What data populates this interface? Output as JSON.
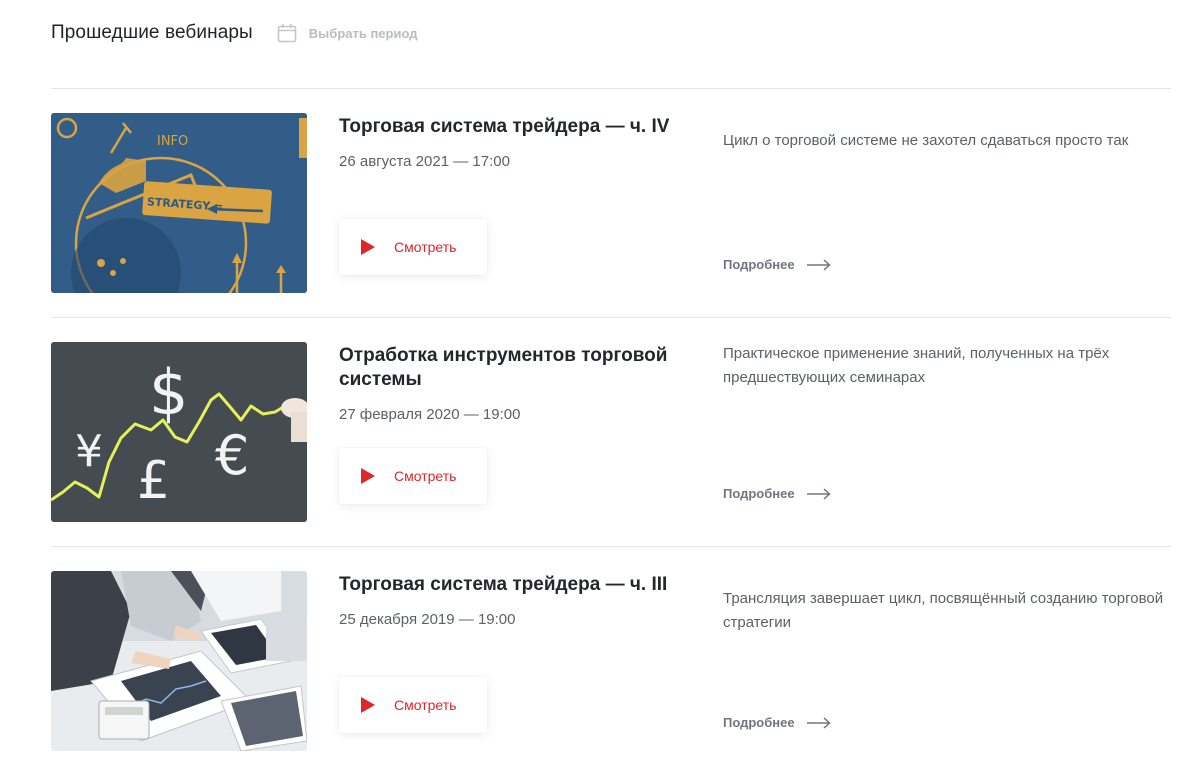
{
  "header": {
    "title": "Прошедшие вебинары",
    "period_label": "Выбрать период"
  },
  "webinars": [
    {
      "title": "Торговая система трейдера — ч. IV",
      "date": "26 августа 2021  — 17:00",
      "watch_label": "Смотреть",
      "description": "Цикл о торговой системе не захотел сдаваться просто так",
      "more_label": "Подробнее",
      "image_text_1": "INFO",
      "image_text_2": "STRATEGY ="
    },
    {
      "title": "Отработка инструментов торговой системы",
      "date": "27 февраля 2020  — 19:00",
      "watch_label": "Смотреть",
      "description": "Практическое применение знаний, полученных на трёх предшествующих семинарах",
      "more_label": "Подробнее",
      "image_symbols": [
        "$",
        "¥",
        "£",
        "€"
      ]
    },
    {
      "title": "Торговая система трейдера — ч. III",
      "date": "25 декабря 2019  — 19:00",
      "watch_label": "Смотреть",
      "description": "Трансляция завершает цикл, посвящённый созданию торговой стратегии",
      "more_label": "Подробнее"
    }
  ],
  "colors": {
    "accent_red": "#e0262b",
    "divider": "#e4e6e9",
    "muted_text": "#b8bcc2"
  }
}
